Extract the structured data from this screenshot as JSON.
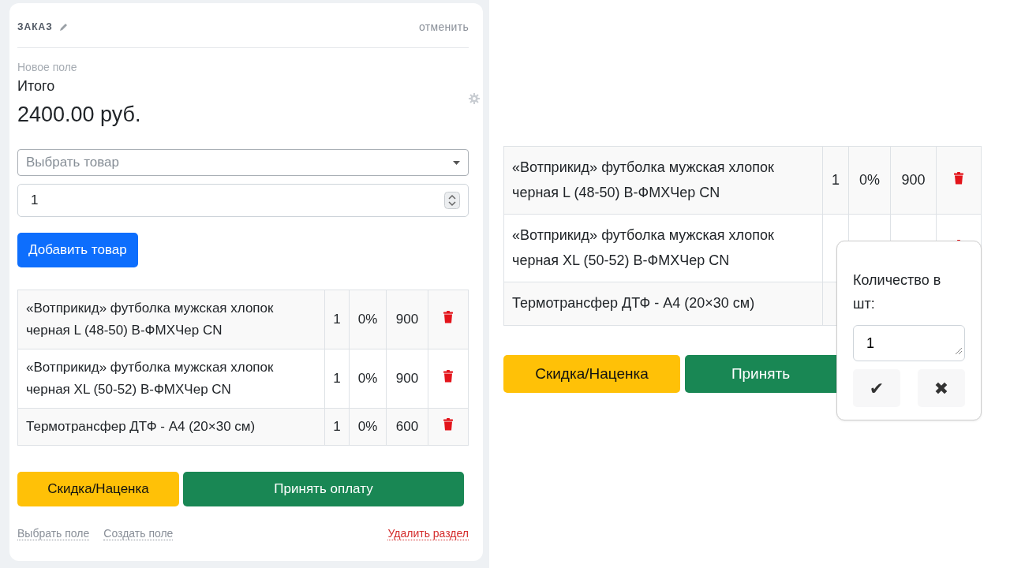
{
  "order_panel": {
    "title": "ЗАКАЗ",
    "cancel_link": "отменить",
    "field_caption": "Новое поле",
    "field_label": "Итого",
    "total": "2400.00 руб.",
    "product_select": {
      "placeholder": "Выбрать товар"
    },
    "quantity_input": {
      "value": "1"
    },
    "add_button": "Добавить товар",
    "items": [
      {
        "name": "«Вотприкид» футболка мужская хлопок черная L (48-50) B-ФМХЧер CN",
        "qty": "1",
        "discount": "0%",
        "price": "900"
      },
      {
        "name": "«Вотприкид» футболка мужская хлопок черная XL (50-52) B-ФМХЧер CN",
        "qty": "1",
        "discount": "0%",
        "price": "900"
      },
      {
        "name": "Термотрансфер ДТФ - А4 (20×30 см)",
        "qty": "1",
        "discount": "0%",
        "price": "600"
      }
    ],
    "buttons": [
      {
        "label": "Скидка/Наценка",
        "kind": "warning"
      },
      {
        "label": "Принять оплату",
        "kind": "success"
      }
    ],
    "footer_links": [
      {
        "label": "Выбрать поле",
        "kind": "muted"
      },
      {
        "label": "Создать поле",
        "kind": "muted"
      },
      {
        "label": "Удалить раздел",
        "kind": "danger"
      }
    ]
  },
  "zoomed_view": {
    "items": [
      {
        "name": "«Вотприкид» футболка мужская хлопок черная L (48-50) B-ФМХЧер CN",
        "qty": "1",
        "discount": "0%",
        "price": "900"
      },
      {
        "name": "«Вотприкид» футболка мужская хлопок черная XL (50-52) B-ФМХЧер CN"
      },
      {
        "name": "Термотрансфер ДТФ - А4 (20×30 см)"
      }
    ],
    "buttons": [
      {
        "label": "Скидка/Наценка",
        "kind": "warning"
      },
      {
        "label": "Принять",
        "kind": "success"
      }
    ],
    "quantity_popover": {
      "label": "Количество в шт:",
      "value": "1",
      "actions": [
        "✔",
        "✖"
      ]
    }
  }
}
